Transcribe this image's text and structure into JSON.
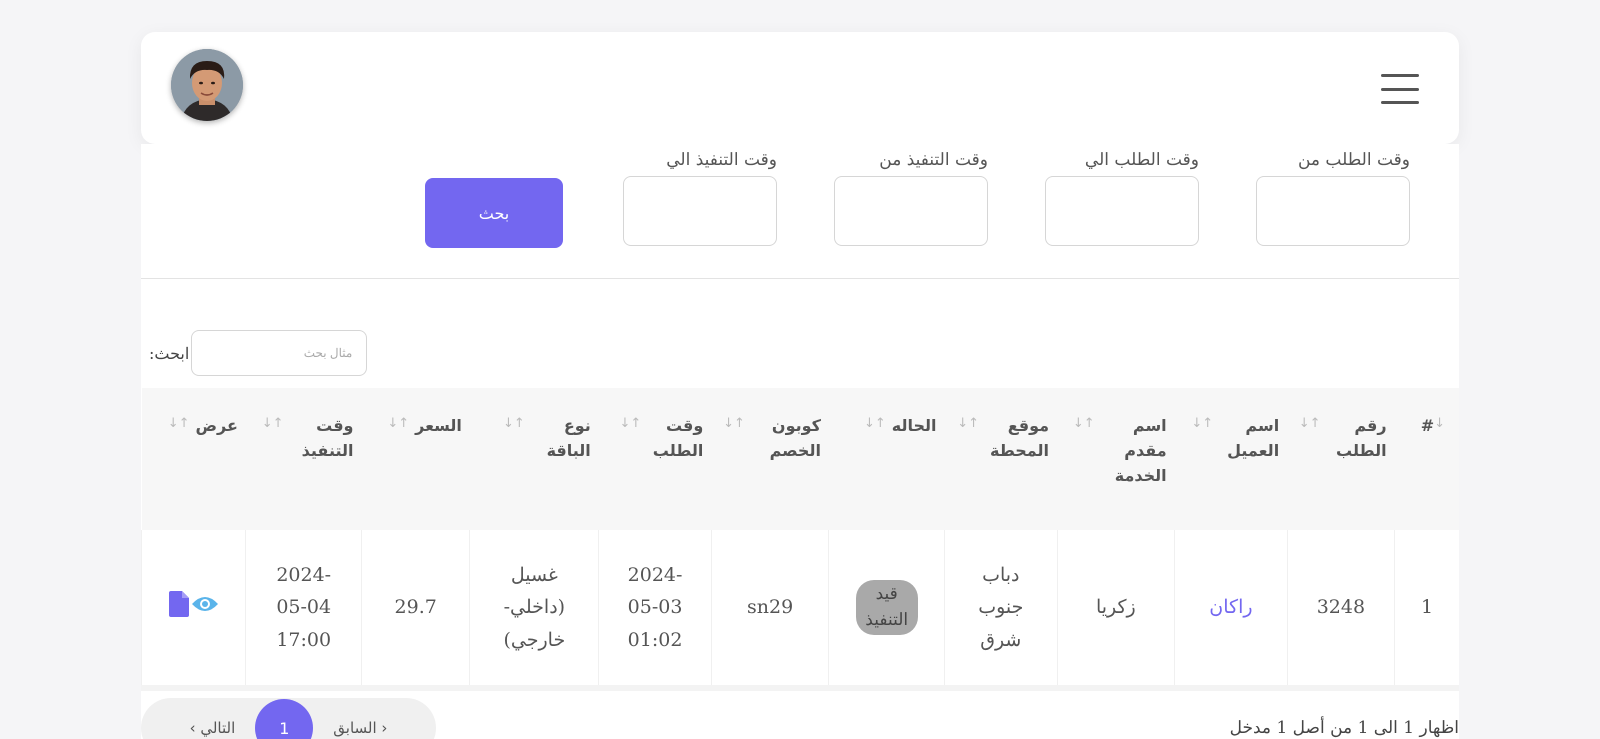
{
  "filters": {
    "order_from_label": "وقت الطلب من",
    "order_to_label": "وقت الطلب الي",
    "exec_from_label": "وقت التنفيذ من",
    "exec_to_label": "وقت التنفيذ الي",
    "search_button": "بحث"
  },
  "table_search": {
    "label": "ابحث:",
    "placeholder": "مثال بحث"
  },
  "table": {
    "headers": [
      "#",
      "رقم الطلب",
      "اسم العميل",
      "اسم مقدم الخدمة",
      "موقع المحطة",
      "الحاله",
      "كوبون الخصم",
      "وقت الطلب",
      "نوع الباقة",
      "السعر",
      "وقت التنفيذ",
      "عرض"
    ],
    "rows": [
      {
        "index": "1",
        "order_no": "3248",
        "customer": "راكان",
        "provider": "زكريا",
        "station": "دباب جنوب شرق",
        "status": "قيد التنفيذ",
        "coupon": "sn29",
        "order_time": "2024-05-03 01:02",
        "package": "غسيل (داخلي-خارجي)",
        "price": "29.7",
        "exec_time": "2024-05-04 17:00"
      }
    ]
  },
  "pagination": {
    "prev": "السابق",
    "page": "1",
    "next": "التالي"
  },
  "info_text": "اظهار 1 الى 1 من أصل 1 مدخل",
  "colors": {
    "accent": "#7367f0",
    "status_bg": "#a9a9a9",
    "view_icon": "#5ab4ea"
  },
  "icons": [
    "menu-icon",
    "eye-icon",
    "file-icon",
    "sort-icon"
  ]
}
